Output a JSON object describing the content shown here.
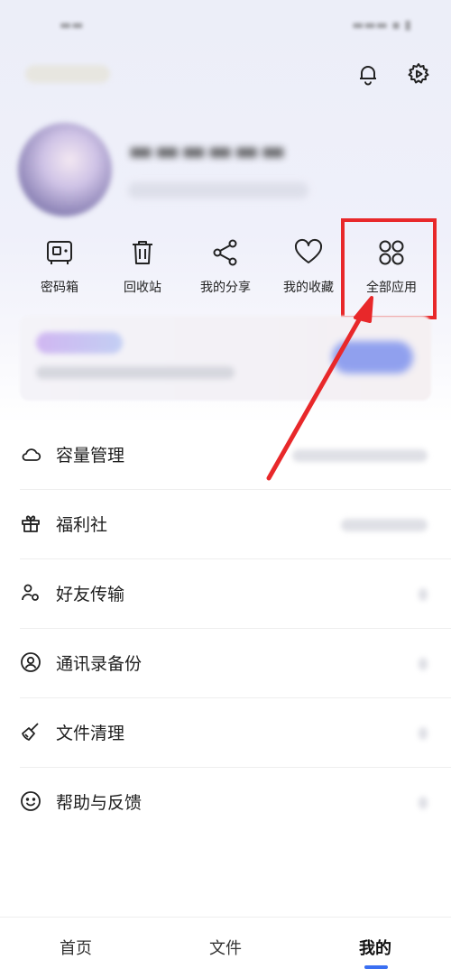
{
  "shortcuts": [
    {
      "label": "密码箱",
      "icon": "safe-icon"
    },
    {
      "label": "回收站",
      "icon": "trash-icon"
    },
    {
      "label": "我的分享",
      "icon": "share-icon"
    },
    {
      "label": "我的收藏",
      "icon": "heart-icon"
    },
    {
      "label": "全部应用",
      "icon": "apps-grid-icon"
    }
  ],
  "menu": [
    {
      "label": "容量管理",
      "icon": "cloud-icon"
    },
    {
      "label": "福利社",
      "icon": "gift-icon"
    },
    {
      "label": "好友传输",
      "icon": "friends-icon"
    },
    {
      "label": "通讯录备份",
      "icon": "contact-icon"
    },
    {
      "label": "文件清理",
      "icon": "broom-icon"
    },
    {
      "label": "帮助与反馈",
      "icon": "smile-icon"
    }
  ],
  "bottom_nav": [
    {
      "label": "首页"
    },
    {
      "label": "文件"
    },
    {
      "label": "我的"
    }
  ],
  "colors": {
    "highlight": "#e8282a",
    "accent": "#3a6ff2"
  }
}
